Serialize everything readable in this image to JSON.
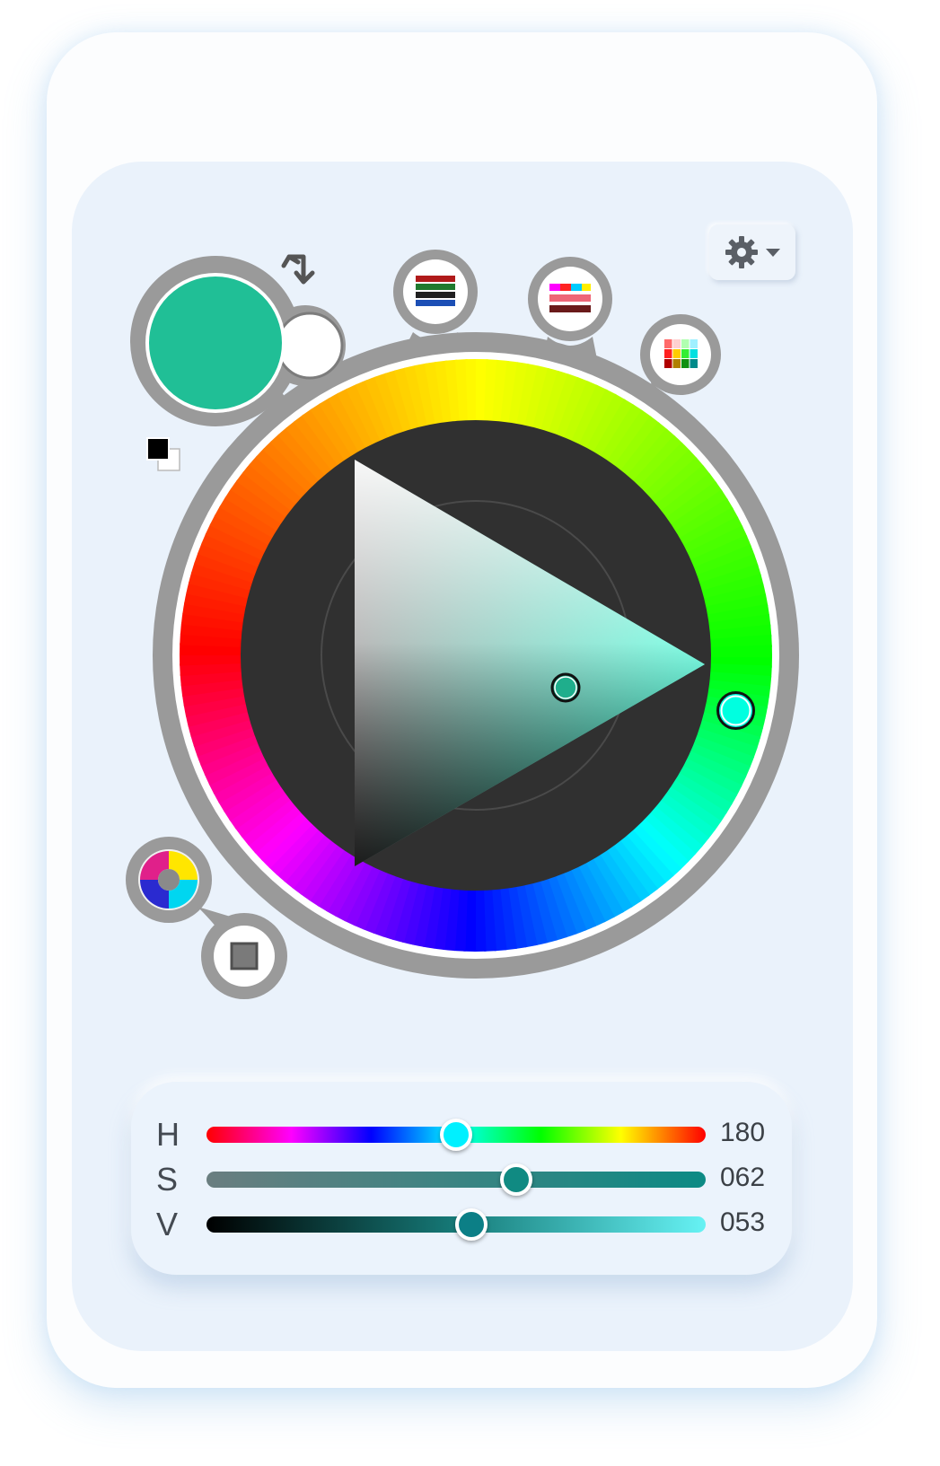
{
  "colors": {
    "current": "#20bf96",
    "previous": "#ffffff",
    "triangle_hue": "#00ffcc",
    "selection_dot": "#1fae8c",
    "wheel_dark": "#303030",
    "frame_gray": "#9a9a9a"
  },
  "icons": {
    "swap": "swap-arrows-icon",
    "reset": "black-white-reset-icon",
    "palette_bars": "color-bars-icon",
    "gradient_bars": "gradient-bars-icon",
    "swatch_grid": "swatch-grid-icon",
    "wheel_mode": "color-wheel-mode-icon",
    "square_mode": "square-mode-icon",
    "settings": "gear-icon",
    "dropdown": "chevron-down-icon"
  },
  "sliders": [
    {
      "label": "H",
      "value": "180",
      "fraction": 0.5,
      "knob_color": "#00f0ff"
    },
    {
      "label": "S",
      "value": "062",
      "fraction": 0.62,
      "knob_color": "#108a82"
    },
    {
      "label": "V",
      "value": "053",
      "fraction": 0.53,
      "knob_color": "#0c7f86"
    }
  ],
  "hue_marker_degrees": 180
}
